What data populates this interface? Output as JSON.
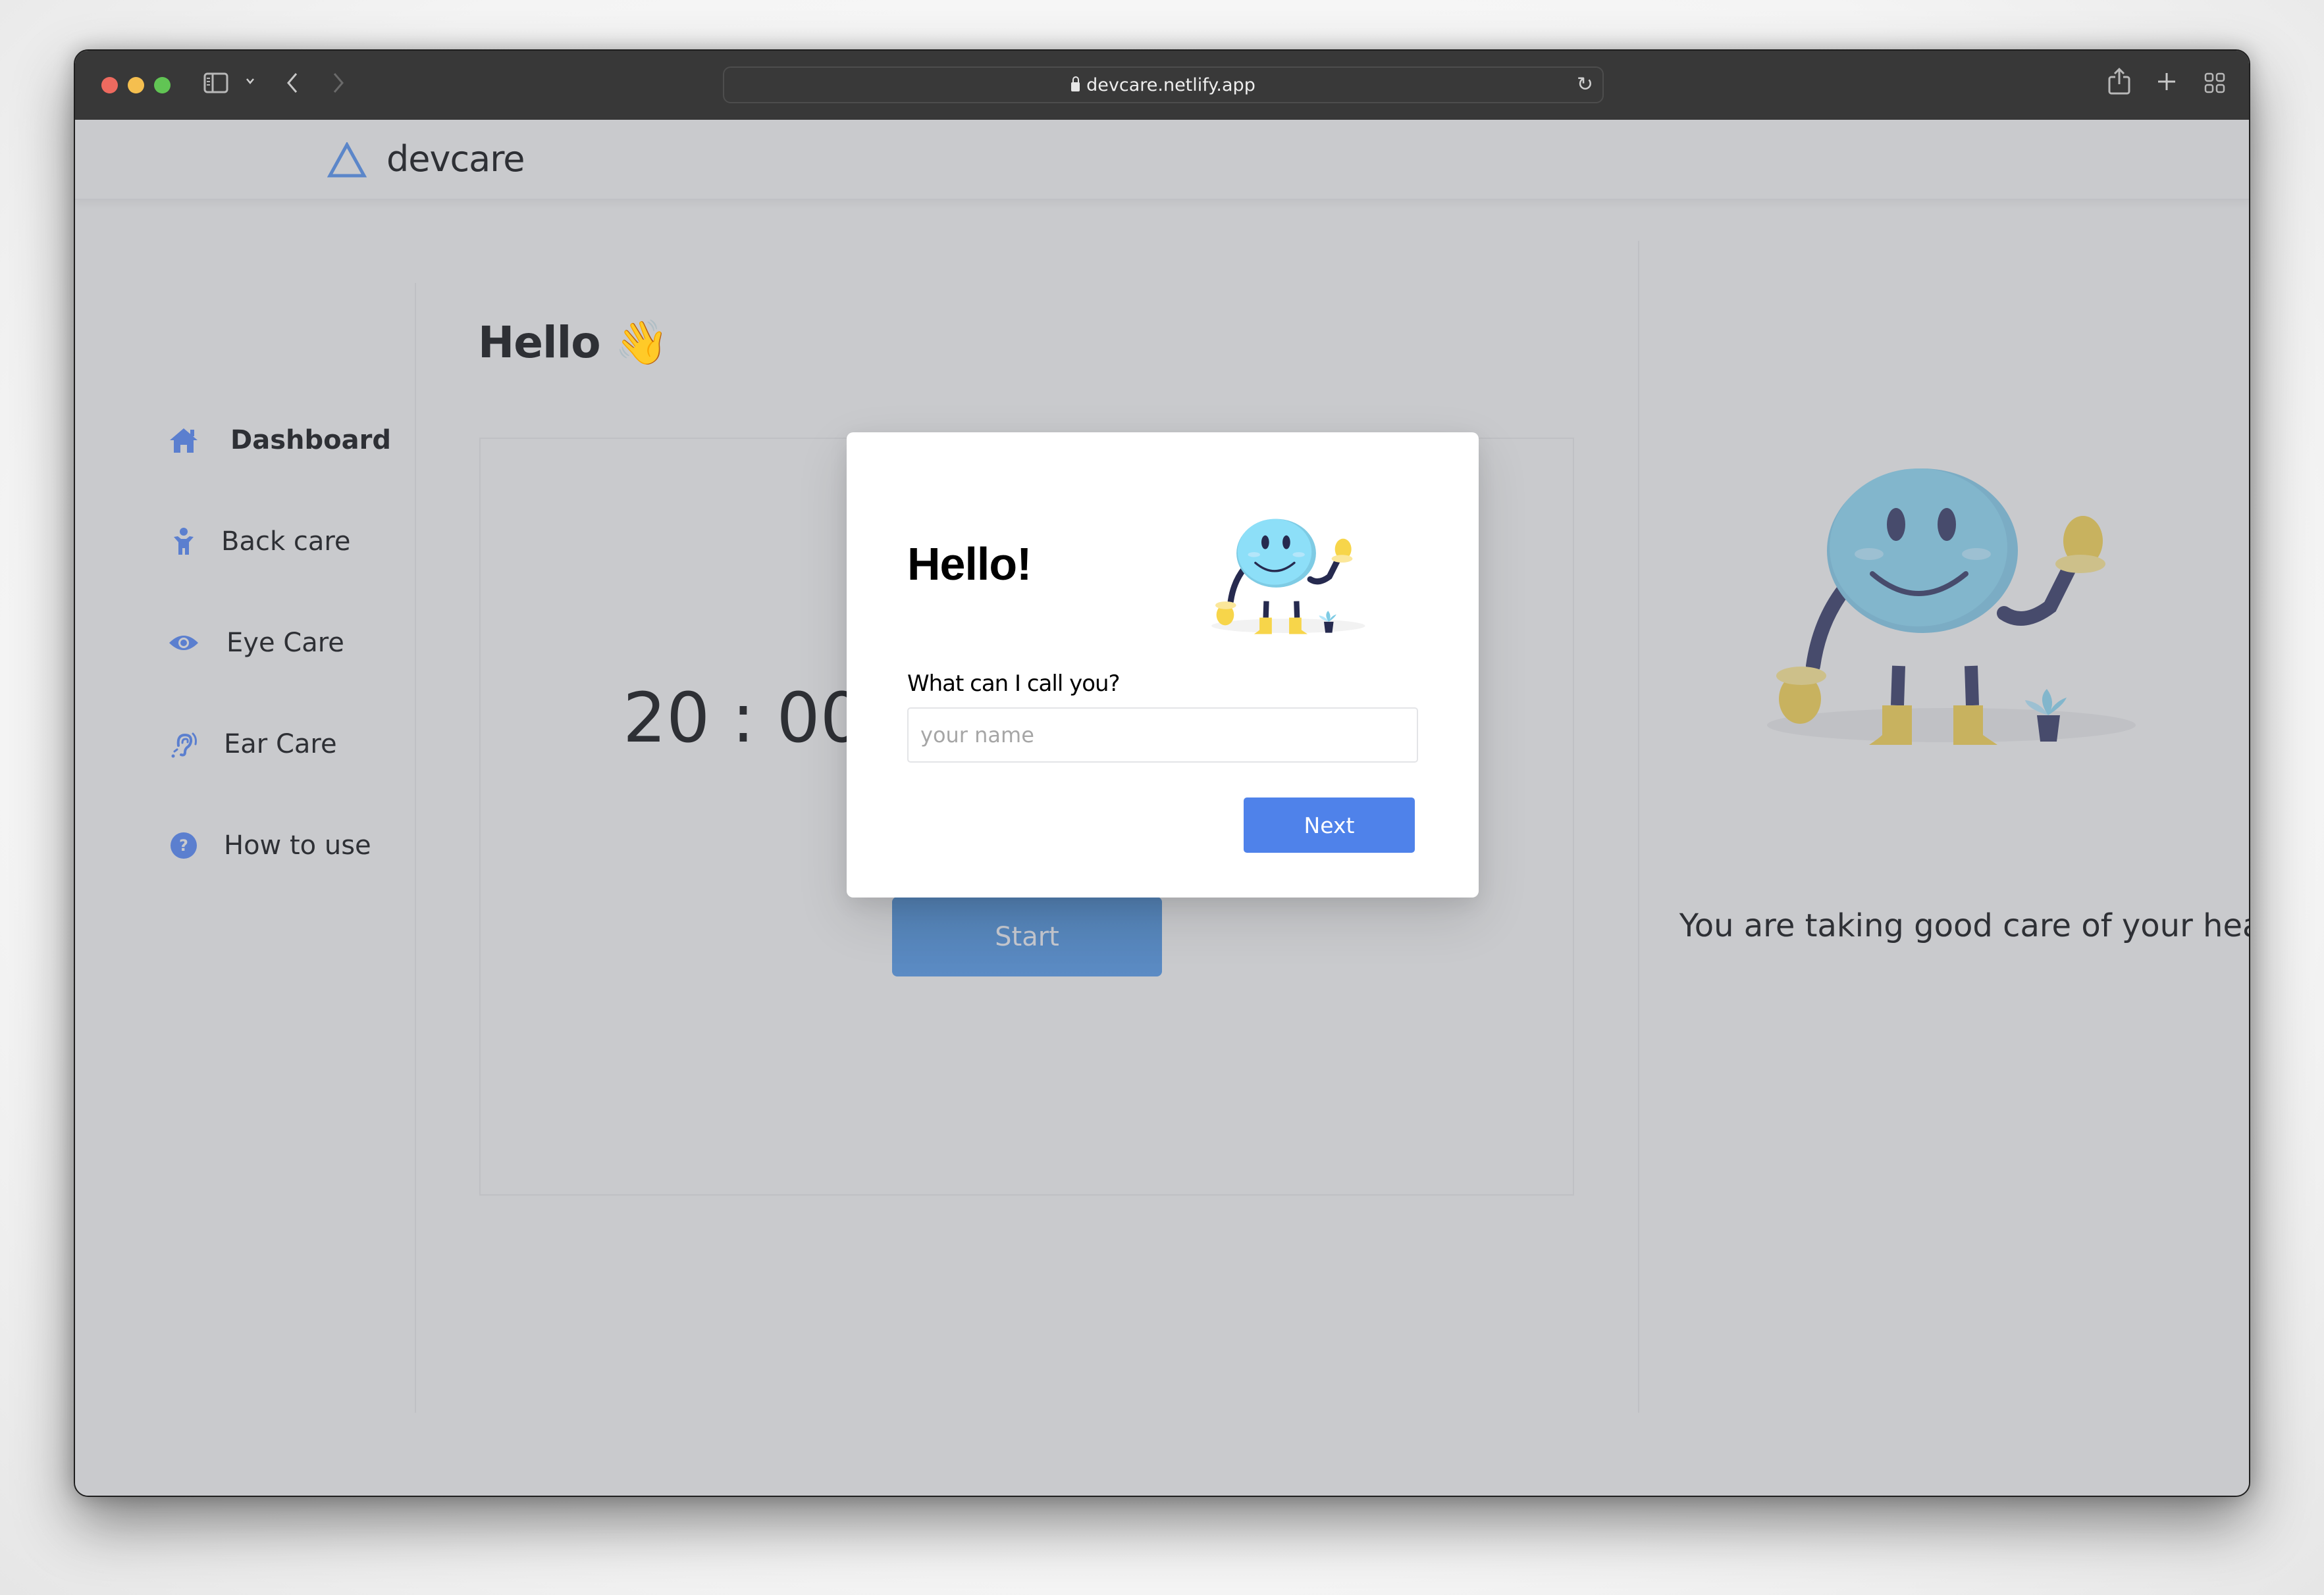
{
  "browser": {
    "url": "devcare.netlify.app",
    "traffic_lights": {
      "close": "#ee6a5f",
      "minimize": "#f5bf4f",
      "zoom": "#61c554"
    },
    "icons": [
      "sidebar-toggle-icon",
      "chevron-down-icon",
      "back-arrow-icon",
      "forward-arrow-icon",
      "lock-icon",
      "reload-icon",
      "share-icon",
      "new-tab-icon",
      "tab-overview-icon"
    ]
  },
  "app": {
    "logo_text": "devcare",
    "accent_color": "#5b86c9"
  },
  "sidebar": {
    "items": [
      {
        "label": "Dashboard",
        "icon": "home-icon",
        "active": true
      },
      {
        "label": "Back care",
        "icon": "person-icon",
        "active": false
      },
      {
        "label": "Eye Care",
        "icon": "eye-icon",
        "active": false
      },
      {
        "label": "Ear Care",
        "icon": "ear-icon",
        "active": false
      },
      {
        "label": "How to use",
        "icon": "question-circle-icon",
        "active": false
      }
    ]
  },
  "main": {
    "greeting": "Hello",
    "greeting_emoji": "👋",
    "timer": "20 : 00",
    "start_label": "Start"
  },
  "right_panel": {
    "message": "You are taking good care of your health!"
  },
  "modal": {
    "title": "Hello!",
    "question": "What can I call you?",
    "name_value": "",
    "name_placeholder": "your name",
    "next_label": "Next",
    "button_color": "#4f82ea"
  }
}
